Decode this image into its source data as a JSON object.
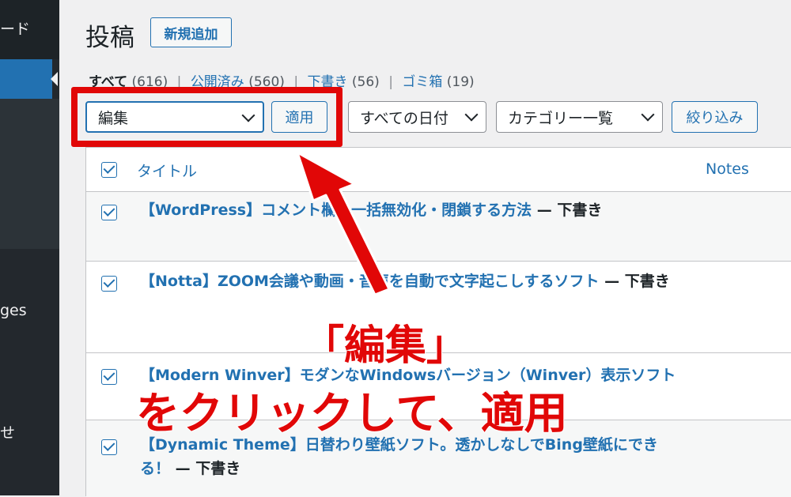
{
  "sidebar": {
    "top_text": "ード",
    "item_pages": "ges",
    "item_other": "せ"
  },
  "header": {
    "title": "投稿",
    "add_new": "新規追加"
  },
  "filters": {
    "all_label": "すべて",
    "all_count": "(616)",
    "published_label": "公開済み",
    "published_count": "(560)",
    "draft_label": "下書き",
    "draft_count": "(56)",
    "trash_label": "ゴミ箱",
    "trash_count": "(19)"
  },
  "controls": {
    "bulk_action": "編集",
    "apply": "適用",
    "date_filter": "すべての日付",
    "category_filter": "カテゴリー一覧",
    "filter_button": "絞り込み"
  },
  "table": {
    "columns": {
      "title": "タイトル",
      "notes": "Notes"
    },
    "rows": [
      {
        "title": "【WordPress】コメント欄を一括無効化・閉鎖する方法",
        "state": " — 下書き",
        "checked": true
      },
      {
        "title": "【Notta】ZOOM会議や動画・音声を自動で文字起こしするソフト",
        "state": " — 下書き",
        "checked": true
      },
      {
        "title": "【Modern Winver】モダンなWindowsバージョン（Winver）表示ソフト",
        "state": "",
        "checked": true
      },
      {
        "title": "【Dynamic Theme】日替わり壁紙ソフト。透かしなしでBing壁紙にできる！",
        "state": " — 下書き",
        "checked": true
      }
    ]
  },
  "annotation": {
    "line1": "「編集」",
    "line2": "をクリックして、適用",
    "color": "#e10707"
  }
}
